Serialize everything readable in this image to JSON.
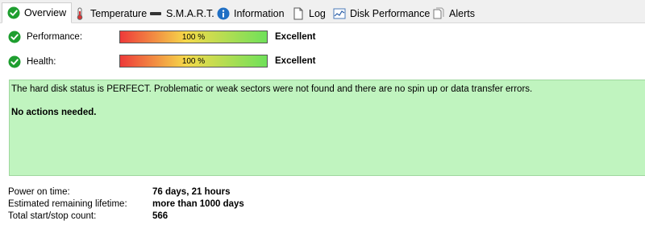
{
  "tabs": [
    {
      "label": "Overview",
      "icon": "check-circle-icon",
      "active": true
    },
    {
      "label": "Temperature",
      "icon": "thermometer-icon",
      "active": false
    },
    {
      "label": "S.M.A.R.T.",
      "icon": "drive-icon",
      "active": false
    },
    {
      "label": "Information",
      "icon": "info-icon",
      "active": false
    },
    {
      "label": "Log",
      "icon": "document-icon",
      "active": false
    },
    {
      "label": "Disk Performance",
      "icon": "chart-icon",
      "active": false
    },
    {
      "label": "Alerts",
      "icon": "pages-icon",
      "active": false
    }
  ],
  "metrics": [
    {
      "label": "Performance:",
      "percent_text": "100 %",
      "value_fraction": 1.0,
      "rating": "Excellent"
    },
    {
      "label": "Health:",
      "percent_text": "100 %",
      "value_fraction": 1.0,
      "rating": "Excellent"
    }
  ],
  "status": {
    "message": "The hard disk status is PERFECT. Problematic or weak sectors were not found and there are no spin up or data transfer errors.",
    "action": "No actions needed."
  },
  "info": [
    {
      "label": "Power on time:",
      "value": "76 days, 21 hours"
    },
    {
      "label": "Estimated remaining lifetime:",
      "value": "more than 1000 days"
    },
    {
      "label": "Total start/stop count:",
      "value": "566"
    }
  ],
  "colors": {
    "status_background": "#c0f4bf",
    "check_green": "#1e9e2f",
    "bar_red": "#ee3a3a",
    "bar_yellow": "#f5d94a",
    "bar_green": "#6fe15a"
  }
}
